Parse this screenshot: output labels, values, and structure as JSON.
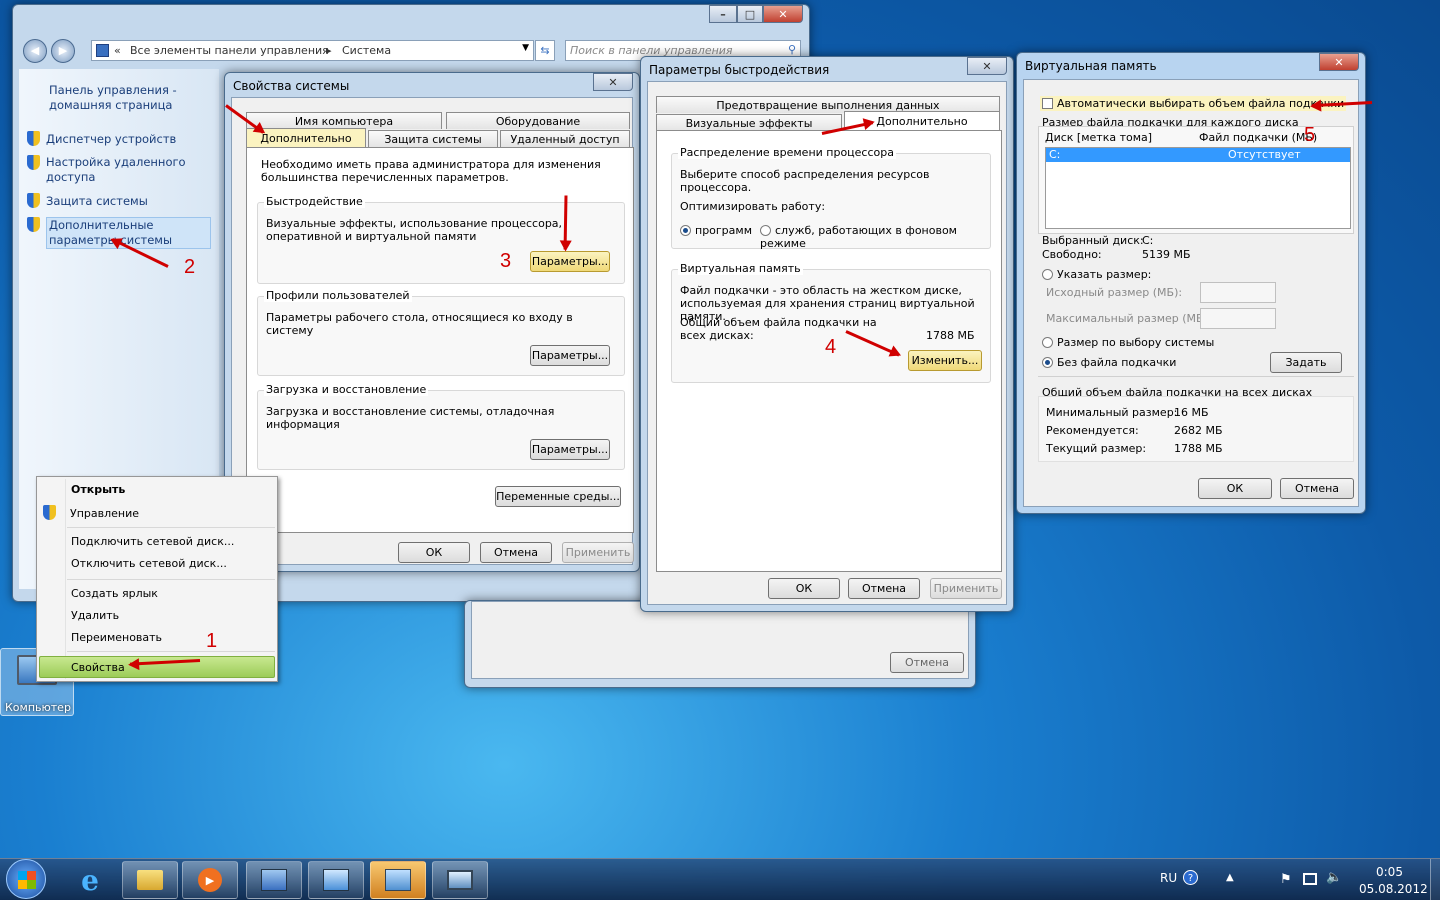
{
  "explorer": {
    "breadcrumb_prefix": "«",
    "breadcrumb_1": "Все элементы панели управления",
    "breadcrumb_sep": "▸",
    "breadcrumb_2": "Система",
    "search_placeholder": "Поиск в панели управления",
    "cancel_label": "Отмена",
    "sidebar": [
      {
        "label": "Панель управления - домашняя страница"
      },
      {
        "label": "Диспетчер устройств"
      },
      {
        "label": "Настройка удаленного доступа"
      },
      {
        "label": "Защита системы"
      },
      {
        "label": "Дополнительные параметры системы"
      }
    ]
  },
  "sysprops": {
    "title": "Свойства системы",
    "tabs_row1": [
      "Имя компьютера",
      "Оборудование"
    ],
    "tabs_row2": [
      "Дополнительно",
      "Защита системы",
      "Удаленный доступ"
    ],
    "admin_note": "Необходимо иметь права администратора для изменения большинства перечисленных параметров.",
    "perf_title": "Быстродействие",
    "perf_text": "Визуальные эффекты, использование процессора, оперативной и виртуальной памяти",
    "profiles_title": "Профили пользователей",
    "profiles_text": "Параметры рабочего стола, относящиеся ко входу в систему",
    "boot_title": "Загрузка и восстановление",
    "boot_text": "Загрузка и восстановление системы, отладочная информация",
    "params_btn": "Параметры...",
    "env_btn": "Переменные среды...",
    "ok": "ОК",
    "cancel": "Отмена",
    "apply": "Применить"
  },
  "perfopts": {
    "title": "Параметры быстродействия",
    "tab_dep": "Предотвращение выполнения данных",
    "tab_visual": "Визуальные эффекты",
    "tab_adv": "Дополнительно",
    "cpu_title": "Распределение времени процессора",
    "cpu_text": "Выберите способ распределения ресурсов процессора.",
    "optimize": "Оптимизировать работу:",
    "opt_programs": "программ",
    "opt_services": "служб, работающих в фоновом режиме",
    "vm_title": "Виртуальная память",
    "vm_text": "Файл подкачки - это область на жестком диске, используемая для хранения страниц виртуальной памяти.",
    "vm_total_label": "Общий объем файла подкачки на всех дисках:",
    "vm_total_value": "1788 МБ",
    "change_btn": "Изменить...",
    "ok": "ОК",
    "cancel": "Отмена",
    "apply": "Применить"
  },
  "virtmem": {
    "title": "Виртуальная память",
    "auto": "Автоматически выбирать объем файла подкачки",
    "per_disk": "Размер файла подкачки для каждого диска",
    "col_disk": "Диск [метка тома]",
    "col_file": "Файл подкачки (МБ)",
    "row_disk": "C:",
    "row_file": "Отсутствует",
    "sel_disk_label": "Выбранный диск:",
    "sel_disk_value": "C:",
    "free_label": "Свободно:",
    "free_value": "5139 МБ",
    "custom": "Указать размер:",
    "initial": "Исходный размер (МБ):",
    "maximum": "Максимальный размер (МБ):",
    "system": "Размер по выбору системы",
    "none": "Без файла подкачки",
    "set_btn": "Задать",
    "total_title": "Общий объем файла подкачки на всех дисках",
    "min_label": "Минимальный размер:",
    "min_value": "16 МБ",
    "rec_label": "Рекомендуется:",
    "rec_value": "2682 МБ",
    "cur_label": "Текущий размер:",
    "cur_value": "1788 МБ",
    "ok": "ОК",
    "cancel": "Отмена"
  },
  "context_menu": {
    "items": [
      "Открыть",
      "Управление",
      "Подключить сетевой диск...",
      "Отключить сетевой диск...",
      "Создать ярлык",
      "Удалить",
      "Переименовать",
      "Свойства"
    ]
  },
  "desktop": {
    "computer_label": "Компьютер"
  },
  "annotations": [
    "1",
    "2",
    "3",
    "4",
    "5"
  ],
  "taskbar": {
    "lang": "RU",
    "time": "0:05",
    "date": "05.08.2012"
  }
}
